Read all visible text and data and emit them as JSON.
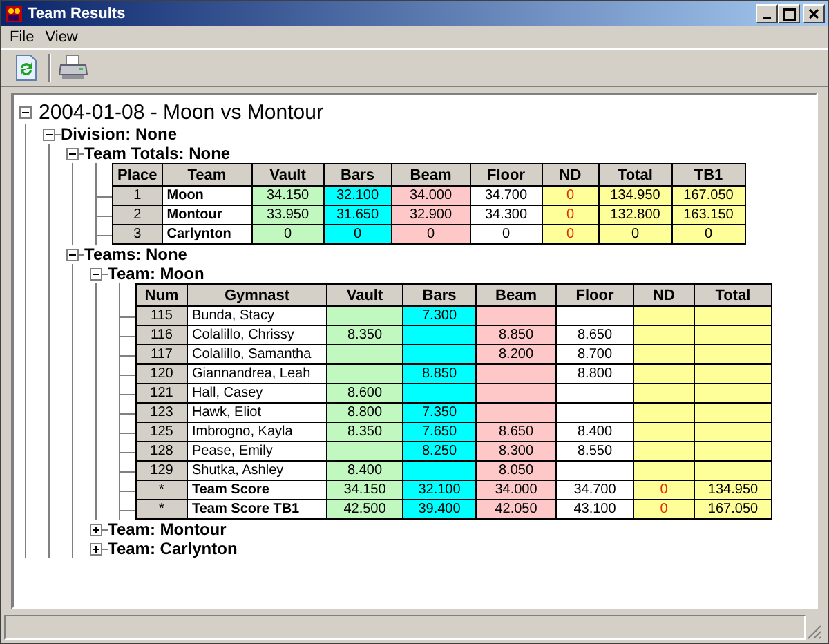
{
  "window": {
    "title": "Team Results"
  },
  "menu": [
    "File",
    "View"
  ],
  "tree": {
    "label": "2004-01-08 - Moon vs Montour",
    "kind": "root",
    "expanded": true,
    "children": [
      {
        "label": "Division: None",
        "expanded": true,
        "children": [
          {
            "label": "Team Totals: None",
            "expanded": true,
            "table": {
              "columns": [
                {
                  "label": "Place",
                  "kind": "index"
                },
                {
                  "label": "Team",
                  "kind": "name"
                },
                {
                  "label": "Vault",
                  "kind": "score",
                  "color": "#c0f8c0"
                },
                {
                  "label": "Bars",
                  "kind": "score",
                  "color": "#00ffff"
                },
                {
                  "label": "Beam",
                  "kind": "score",
                  "color": "#ffc8c8"
                },
                {
                  "label": "Floor",
                  "kind": "score",
                  "color": "#ffffff"
                },
                {
                  "label": "ND",
                  "kind": "deduction",
                  "color": "#ffff99"
                },
                {
                  "label": "Total",
                  "kind": "score",
                  "color": "#ffff99"
                },
                {
                  "label": "TB1",
                  "kind": "score",
                  "color": "#ffff99"
                }
              ],
              "rows": [
                {
                  "kind": "summary",
                  "cells": [
                    "1",
                    "Moon",
                    "34.150",
                    "32.100",
                    "34.000",
                    "34.700",
                    "0",
                    "134.950",
                    "167.050"
                  ]
                },
                {
                  "kind": "summary",
                  "cells": [
                    "2",
                    "Montour",
                    "33.950",
                    "31.650",
                    "32.900",
                    "34.300",
                    "0",
                    "132.800",
                    "163.150"
                  ]
                },
                {
                  "kind": "summary",
                  "cells": [
                    "3",
                    "Carlynton",
                    "0",
                    "0",
                    "0",
                    "0",
                    "0",
                    "0",
                    "0"
                  ]
                }
              ]
            }
          },
          {
            "label": "Teams: None",
            "expanded": true,
            "children": [
              {
                "label": "Team: Moon",
                "expanded": true,
                "table": {
                  "columns": [
                    {
                      "label": "Num",
                      "kind": "index"
                    },
                    {
                      "label": "Gymnast",
                      "kind": "name"
                    },
                    {
                      "label": "Vault",
                      "kind": "score",
                      "color": "#c0f8c0"
                    },
                    {
                      "label": "Bars",
                      "kind": "score",
                      "color": "#00ffff"
                    },
                    {
                      "label": "Beam",
                      "kind": "score",
                      "color": "#ffc8c8"
                    },
                    {
                      "label": "Floor",
                      "kind": "score",
                      "color": "#ffffff"
                    },
                    {
                      "label": "ND",
                      "kind": "deduction",
                      "color": "#ffff99"
                    },
                    {
                      "label": "Total",
                      "kind": "score",
                      "color": "#ffff99"
                    }
                  ],
                  "rows": [
                    {
                      "kind": "gymnast",
                      "cells": [
                        "115",
                        "Bunda, Stacy",
                        "",
                        "7.300",
                        "",
                        "",
                        "",
                        ""
                      ]
                    },
                    {
                      "kind": "gymnast",
                      "cells": [
                        "116",
                        "Colalillo, Chrissy",
                        "8.350",
                        "",
                        "8.850",
                        "8.650",
                        "",
                        ""
                      ]
                    },
                    {
                      "kind": "gymnast",
                      "cells": [
                        "117",
                        "Colalillo, Samantha",
                        "",
                        "",
                        "8.200",
                        "8.700",
                        "",
                        ""
                      ]
                    },
                    {
                      "kind": "gymnast",
                      "cells": [
                        "120",
                        "Giannandrea, Leah",
                        "",
                        "8.850",
                        "",
                        "8.800",
                        "",
                        ""
                      ]
                    },
                    {
                      "kind": "gymnast",
                      "cells": [
                        "121",
                        "Hall, Casey",
                        "8.600",
                        "",
                        "",
                        "",
                        "",
                        ""
                      ]
                    },
                    {
                      "kind": "gymnast",
                      "cells": [
                        "123",
                        "Hawk, Eliot",
                        "8.800",
                        "7.350",
                        "",
                        "",
                        "",
                        ""
                      ]
                    },
                    {
                      "kind": "gymnast",
                      "cells": [
                        "125",
                        "Imbrogno, Kayla",
                        "8.350",
                        "7.650",
                        "8.650",
                        "8.400",
                        "",
                        ""
                      ]
                    },
                    {
                      "kind": "gymnast",
                      "cells": [
                        "128",
                        "Pease, Emily",
                        "",
                        "8.250",
                        "8.300",
                        "8.550",
                        "",
                        ""
                      ]
                    },
                    {
                      "kind": "gymnast",
                      "cells": [
                        "129",
                        "Shutka, Ashley",
                        "8.400",
                        "",
                        "8.050",
                        "",
                        "",
                        ""
                      ]
                    },
                    {
                      "kind": "summary",
                      "cells": [
                        "*",
                        "Team Score",
                        "34.150",
                        "32.100",
                        "34.000",
                        "34.700",
                        "0",
                        "134.950"
                      ]
                    },
                    {
                      "kind": "summary",
                      "cells": [
                        "*",
                        "Team Score TB1",
                        "42.500",
                        "39.400",
                        "42.050",
                        "43.100",
                        "0",
                        "167.050"
                      ]
                    }
                  ]
                }
              },
              {
                "label": "Team: Montour",
                "expanded": false
              },
              {
                "label": "Team: Carlynton",
                "expanded": false
              }
            ]
          }
        ]
      }
    ]
  }
}
